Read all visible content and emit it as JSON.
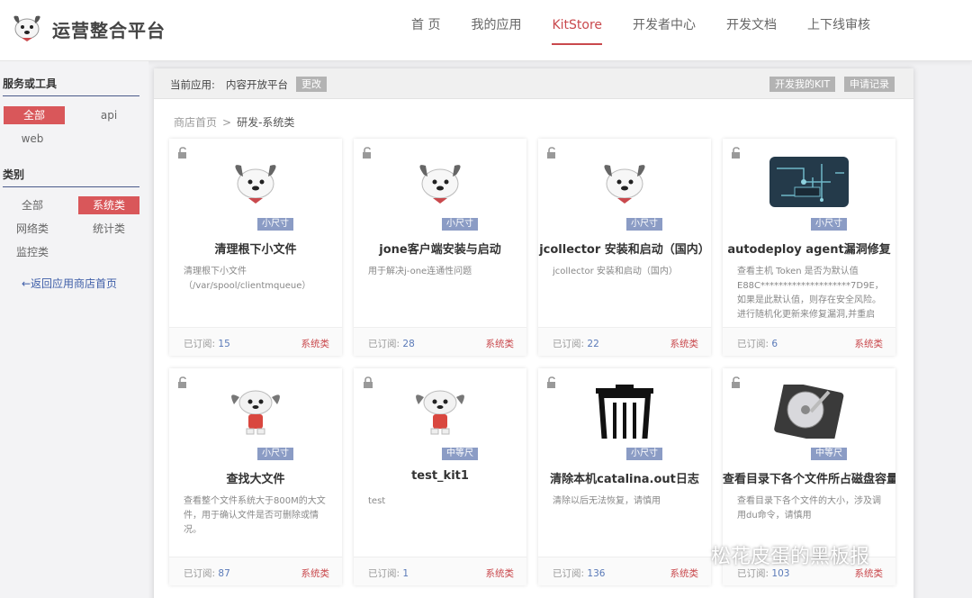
{
  "brand": "运营整合平台",
  "nav": [
    "首 页",
    "我的应用",
    "KitStore",
    "开发者中心",
    "开发文档",
    "上下线审核"
  ],
  "nav_active": 2,
  "sidebar": {
    "section1_title": "服务或工具",
    "section1_items": [
      "全部",
      "api",
      "web"
    ],
    "section2_title": "类别",
    "section2_items": [
      "全部",
      "系统类",
      "网络类",
      "统计类",
      "监控类"
    ],
    "back_link": "←返回应用商店首页"
  },
  "toolbar": {
    "current_app_label": "当前应用:",
    "current_app_value": "内容开放平台",
    "change_button": "更改",
    "develop_kit_button": "开发我的KIT",
    "apply_record_button": "申请记录"
  },
  "breadcrumb": {
    "root": "商店首页",
    "separator": ">",
    "current": "研发-系统类"
  },
  "subs_label": "已订阅:",
  "cards": [
    {
      "title": "清理根下小文件",
      "desc": "清理根下小文件（/var/spool/clientmqueue）",
      "size": "小尺寸",
      "subs": "15",
      "cat": "系统类",
      "icon": "mascot-dog-icon"
    },
    {
      "title": "jone客户端安装与启动",
      "desc": "用于解决j-one连通性问题",
      "size": "小尺寸",
      "subs": "28",
      "cat": "系统类",
      "icon": "mascot-dog-icon"
    },
    {
      "title": "jcollector 安装和启动（国内）",
      "desc": "jcollector 安装和启动（国内）",
      "size": "小尺寸",
      "subs": "22",
      "cat": "系统类",
      "icon": "mascot-dog-icon"
    },
    {
      "title": "autodeploy agent漏洞修复",
      "desc": "查看主机 Token 是否为默认值 E88C********************7D9E，如果是此默认值，则存在安全风险。进行随机化更新来修复漏洞,并重启",
      "size": "小尺寸",
      "subs": "6",
      "cat": "系统类",
      "icon": "circuit-board-icon"
    },
    {
      "title": "查找大文件",
      "desc": "查看整个文件系统大于800M的大文件，用于确认文件是否可删除或情况。",
      "size": "小尺寸",
      "subs": "87",
      "cat": "系统类",
      "icon": "mascot-dog-standing-icon"
    },
    {
      "title": "test_kit1",
      "desc": "test",
      "size": "中等尺",
      "subs": "1",
      "cat": "系统类",
      "icon": "mascot-dog-standing-icon"
    },
    {
      "title": "清除本机catalina.out日志",
      "desc": "清除以后无法恢复，请慎用",
      "size": "小尺寸",
      "subs": "136",
      "cat": "系统类",
      "icon": "trash-icon"
    },
    {
      "title": "查看目录下各个文件所占磁盘容量",
      "desc": "查看目录下各个文件的大小，涉及调用du命令，请慎用",
      "size": "中等尺",
      "subs": "103",
      "cat": "系统类",
      "icon": "hard-drive-icon"
    }
  ],
  "watermark": "松花皮蛋的黑板报",
  "colors": {
    "accent": "#c9494d",
    "badge": "#8b9cc5",
    "link": "#3e5ea8"
  }
}
